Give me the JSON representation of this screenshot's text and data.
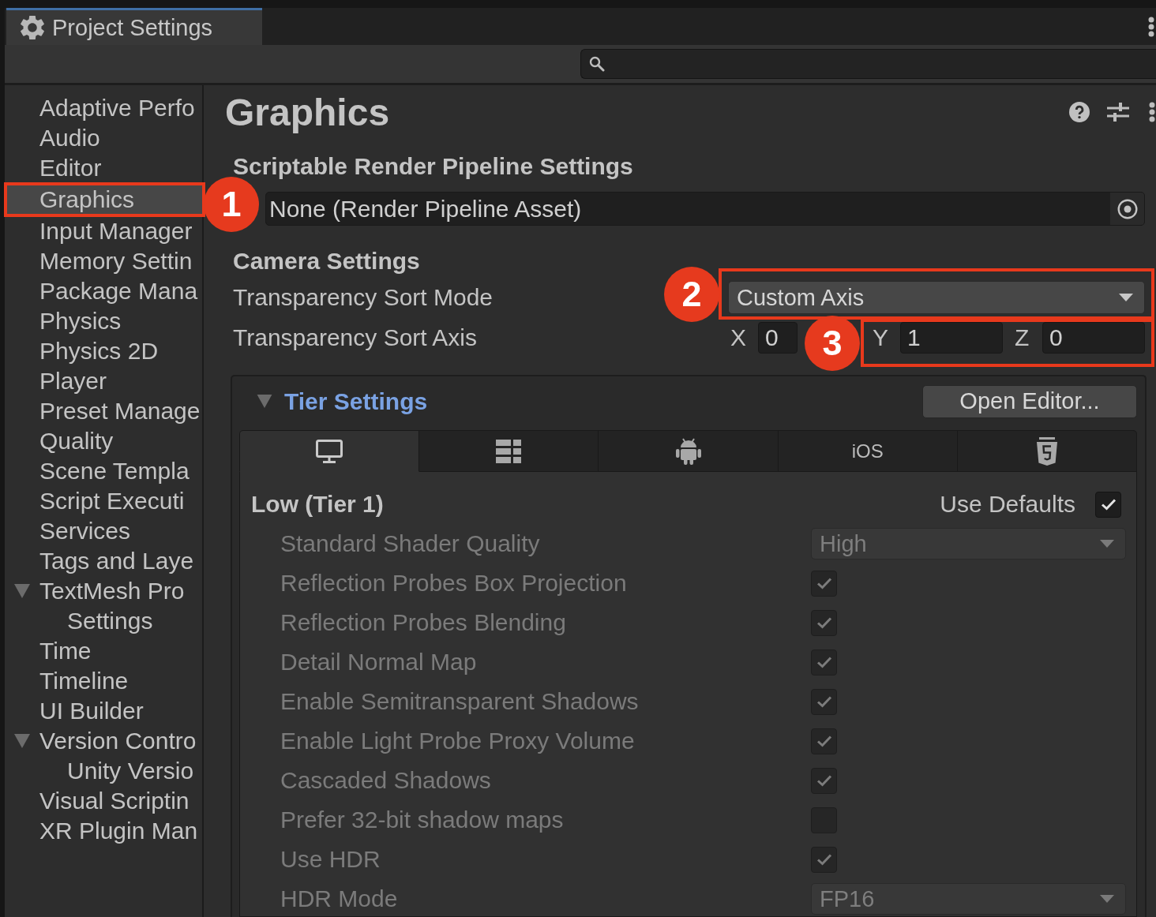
{
  "window": {
    "tab_title": "Project Settings"
  },
  "sidebar": {
    "items": [
      {
        "label": "Adaptive Perfo",
        "selected": false
      },
      {
        "label": "Audio",
        "selected": false
      },
      {
        "label": "Editor",
        "selected": false
      },
      {
        "label": "Graphics",
        "selected": true,
        "callout": "1"
      },
      {
        "label": "Input Manager",
        "selected": false
      },
      {
        "label": "Memory Settin",
        "selected": false
      },
      {
        "label": "Package Mana",
        "selected": false
      },
      {
        "label": "Physics",
        "selected": false
      },
      {
        "label": "Physics 2D",
        "selected": false
      },
      {
        "label": "Player",
        "selected": false
      },
      {
        "label": "Preset Manage",
        "selected": false
      },
      {
        "label": "Quality",
        "selected": false
      },
      {
        "label": "Scene Templa",
        "selected": false
      },
      {
        "label": "Script Executi",
        "selected": false
      },
      {
        "label": "Services",
        "selected": false
      },
      {
        "label": "Tags and Laye",
        "selected": false
      },
      {
        "label": "TextMesh Pro",
        "selected": false,
        "expanded": true,
        "children": [
          {
            "label": "Settings",
            "selected": false
          }
        ]
      },
      {
        "label": "Time",
        "selected": false
      },
      {
        "label": "Timeline",
        "selected": false
      },
      {
        "label": "UI Builder",
        "selected": false
      },
      {
        "label": "Version Contro",
        "selected": false,
        "expanded": true,
        "children": [
          {
            "label": "Unity Versio",
            "selected": false
          }
        ]
      },
      {
        "label": "Visual Scriptin",
        "selected": false
      },
      {
        "label": "XR Plugin Man",
        "selected": false
      }
    ]
  },
  "inspector": {
    "title": "Graphics",
    "srp_settings": {
      "heading": "Scriptable Render Pipeline Settings",
      "asset": "None (Render Pipeline Asset)"
    },
    "camera_settings": {
      "heading": "Camera Settings",
      "sort_mode": {
        "label": "Transparency Sort Mode",
        "value": "Custom Axis",
        "callout": "2"
      },
      "sort_axis": {
        "label": "Transparency Sort Axis",
        "callout": "3",
        "fields": [
          {
            "axis": "X",
            "value": "0",
            "highlighted": false
          },
          {
            "axis": "Y",
            "value": "1",
            "highlighted": true
          },
          {
            "axis": "Z",
            "value": "0",
            "highlighted": true
          }
        ]
      }
    },
    "tier_settings": {
      "title": "Tier Settings",
      "expanded": true,
      "button": "Open Editor...",
      "platform_tabs": [
        {
          "kind": "desktop",
          "selected": true
        },
        {
          "kind": "server",
          "selected": false
        },
        {
          "kind": "android",
          "selected": false
        },
        {
          "kind": "text",
          "label": "iOS",
          "selected": false
        },
        {
          "kind": "html5",
          "selected": false
        }
      ],
      "tier": {
        "title": "Low (Tier 1)",
        "use_defaults": {
          "label": "Use Defaults",
          "checked": true
        },
        "rows": [
          {
            "label": "Standard Shader Quality",
            "kind": "dropdown",
            "value": "High",
            "disabled": true
          },
          {
            "label": "Reflection Probes Box Projection",
            "kind": "checkbox",
            "checked": true,
            "disabled": true
          },
          {
            "label": "Reflection Probes Blending",
            "kind": "checkbox",
            "checked": true,
            "disabled": true
          },
          {
            "label": "Detail Normal Map",
            "kind": "checkbox",
            "checked": true,
            "disabled": true
          },
          {
            "label": "Enable Semitransparent Shadows",
            "kind": "checkbox",
            "checked": true,
            "disabled": true
          },
          {
            "label": "Enable Light Probe Proxy Volume",
            "kind": "checkbox",
            "checked": true,
            "disabled": true
          },
          {
            "label": "Cascaded Shadows",
            "kind": "checkbox",
            "checked": true,
            "disabled": true
          },
          {
            "label": "Prefer 32-bit shadow maps",
            "kind": "checkbox",
            "checked": false,
            "disabled": true
          },
          {
            "label": "Use HDR",
            "kind": "checkbox",
            "checked": true,
            "disabled": true
          },
          {
            "label": "HDR Mode",
            "kind": "dropdown",
            "value": "FP16",
            "disabled": true
          }
        ]
      }
    }
  }
}
